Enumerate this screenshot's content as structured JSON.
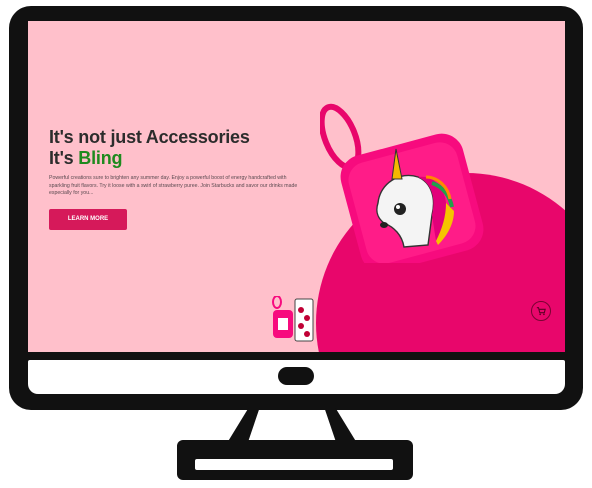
{
  "hero": {
    "title_line1": "It's not just Accessories",
    "title_line2_prefix": "It's ",
    "title_line2_accent": "Bling",
    "description": "Powerful creations sure to brighten any summer day. Enjoy a powerful boost of energy handcrafted with sparkling fruit flavors. Try it loose with a swirl of strawberry puree. Join Starbucks and savor our drinks made especially for you...",
    "cta_label": "LEARN MORE"
  },
  "icons": {
    "cart": "shopping-cart-icon"
  },
  "colors": {
    "screen_bg": "#ffc0cb",
    "accent_magenta": "#e8066b",
    "button": "#d6195a",
    "accent_green": "#1e8a1e",
    "heading": "#2c2c2c",
    "frame": "#111111"
  }
}
